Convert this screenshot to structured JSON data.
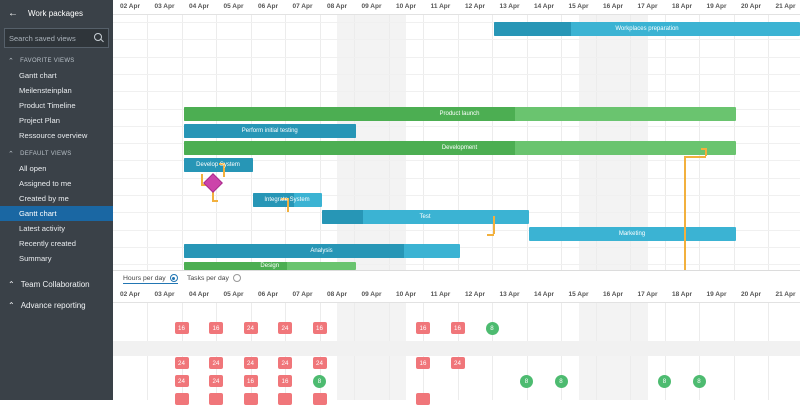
{
  "sidebar": {
    "title": "Work packages",
    "search_placeholder": "Search saved views",
    "favorite_title": "FAVORITE VIEWS",
    "favorites": [
      "Gantt chart",
      "Meilensteinplan",
      "Product Timeline",
      "Project Plan",
      "Ressource overview"
    ],
    "default_title": "DEFAULT VIEWS",
    "defaults": [
      "All open",
      "Assigned to me",
      "Created by me",
      "Gantt chart",
      "Latest activity",
      "Recently created",
      "Summary"
    ],
    "active_default": "Gantt chart",
    "groups": [
      "Team Collaboration",
      "Advance reporting"
    ]
  },
  "timeline": {
    "dates": [
      "02 Apr",
      "03 Apr",
      "04 Apr",
      "05 Apr",
      "06 Apr",
      "07 Apr",
      "08 Apr",
      "09 Apr",
      "10 Apr",
      "11 Apr",
      "12 Apr",
      "13 Apr",
      "14 Apr",
      "15 Apr",
      "16 Apr",
      "17 Apr",
      "18 Apr",
      "19 Apr",
      "20 Apr",
      "21 Apr"
    ],
    "weekend_dates": [
      "08 Apr",
      "09 Apr",
      "15 Apr",
      "16 Apr"
    ]
  },
  "gantt": {
    "bars": [
      {
        "label": "Workplaces preparation",
        "color": "blue",
        "start": "12 Apr",
        "end": "21 Apr",
        "row": 0,
        "progress": 0.25
      },
      {
        "label": "Product launch",
        "color": "green",
        "start": "03 Apr",
        "end": "18 Apr",
        "row": 1,
        "progress": 0.6
      },
      {
        "label": "Perform initial testing",
        "color": "blue",
        "start": "03 Apr",
        "end": "07 Apr",
        "row": 2,
        "progress": 1.0
      },
      {
        "label": "Development",
        "color": "green",
        "start": "03 Apr",
        "end": "18 Apr",
        "row": 3,
        "progress": 0.6
      },
      {
        "label": "Develop System",
        "color": "blue",
        "start": "03 Apr",
        "end": "04 Apr",
        "row": 4,
        "progress": 1.0
      },
      {
        "label": "Integrate System",
        "color": "blue",
        "start": "05 Apr",
        "end": "06 Apr",
        "row": 6,
        "progress": 0.6
      },
      {
        "label": "Test",
        "color": "blue",
        "start": "07 Apr",
        "end": "12 Apr",
        "row": 7,
        "progress": 0.2
      },
      {
        "label": "Marketing",
        "color": "blue",
        "start": "13 Apr",
        "end": "18 Apr",
        "row": 8,
        "progress": 0.0
      },
      {
        "label": "Analysis",
        "color": "blue",
        "start": "03 Apr",
        "end": "10 Apr",
        "row": 9,
        "progress": 0.8
      },
      {
        "label": "Design",
        "color": "green",
        "start": "03 Apr",
        "end": "07 Apr",
        "row": 10,
        "progress": 0.6
      }
    ]
  },
  "resource": {
    "tabs": [
      "Hours per day",
      "Tasks per day"
    ],
    "active_tab": "Hours per day",
    "rows": [
      [],
      [
        {
          "d": "03 Apr",
          "v": "16",
          "t": "over"
        },
        {
          "d": "04 Apr",
          "v": "16",
          "t": "over"
        },
        {
          "d": "05 Apr",
          "v": "24",
          "t": "over"
        },
        {
          "d": "06 Apr",
          "v": "24",
          "t": "over"
        },
        {
          "d": "07 Apr",
          "v": "16",
          "t": "over"
        },
        {
          "d": "10 Apr",
          "v": "16",
          "t": "over"
        },
        {
          "d": "11 Apr",
          "v": "16",
          "t": "over"
        },
        {
          "d": "12 Apr",
          "v": "8",
          "t": "ok"
        }
      ],
      [],
      [
        {
          "d": "03 Apr",
          "v": "24",
          "t": "over"
        },
        {
          "d": "04 Apr",
          "v": "24",
          "t": "over"
        },
        {
          "d": "05 Apr",
          "v": "24",
          "t": "over"
        },
        {
          "d": "06 Apr",
          "v": "24",
          "t": "over"
        },
        {
          "d": "07 Apr",
          "v": "24",
          "t": "over"
        },
        {
          "d": "10 Apr",
          "v": "16",
          "t": "over"
        },
        {
          "d": "11 Apr",
          "v": "24",
          "t": "over"
        }
      ],
      [
        {
          "d": "03 Apr",
          "v": "24",
          "t": "over"
        },
        {
          "d": "04 Apr",
          "v": "24",
          "t": "over"
        },
        {
          "d": "05 Apr",
          "v": "16",
          "t": "over"
        },
        {
          "d": "06 Apr",
          "v": "16",
          "t": "over"
        },
        {
          "d": "07 Apr",
          "v": "8",
          "t": "ok"
        },
        {
          "d": "13 Apr",
          "v": "8",
          "t": "ok"
        },
        {
          "d": "14 Apr",
          "v": "8",
          "t": "ok"
        },
        {
          "d": "17 Apr",
          "v": "8",
          "t": "ok"
        },
        {
          "d": "18 Apr",
          "v": "8",
          "t": "ok"
        }
      ],
      [
        {
          "d": "03 Apr",
          "v": "",
          "t": "over"
        },
        {
          "d": "04 Apr",
          "v": "",
          "t": "over"
        },
        {
          "d": "05 Apr",
          "v": "",
          "t": "over"
        },
        {
          "d": "06 Apr",
          "v": "",
          "t": "over"
        },
        {
          "d": "07 Apr",
          "v": "",
          "t": "over"
        },
        {
          "d": "10 Apr",
          "v": "",
          "t": "over"
        }
      ]
    ],
    "grey_rows": [
      2
    ]
  },
  "colors": {
    "sidebar_bg": "#3a4148",
    "active": "#1a67a3",
    "green": "#6ac46f",
    "blue": "#3bb3d3",
    "over": "#f0767a",
    "ok": "#4dbb70",
    "milestone": "#cc44aa",
    "dependency": "#f2b03d"
  }
}
